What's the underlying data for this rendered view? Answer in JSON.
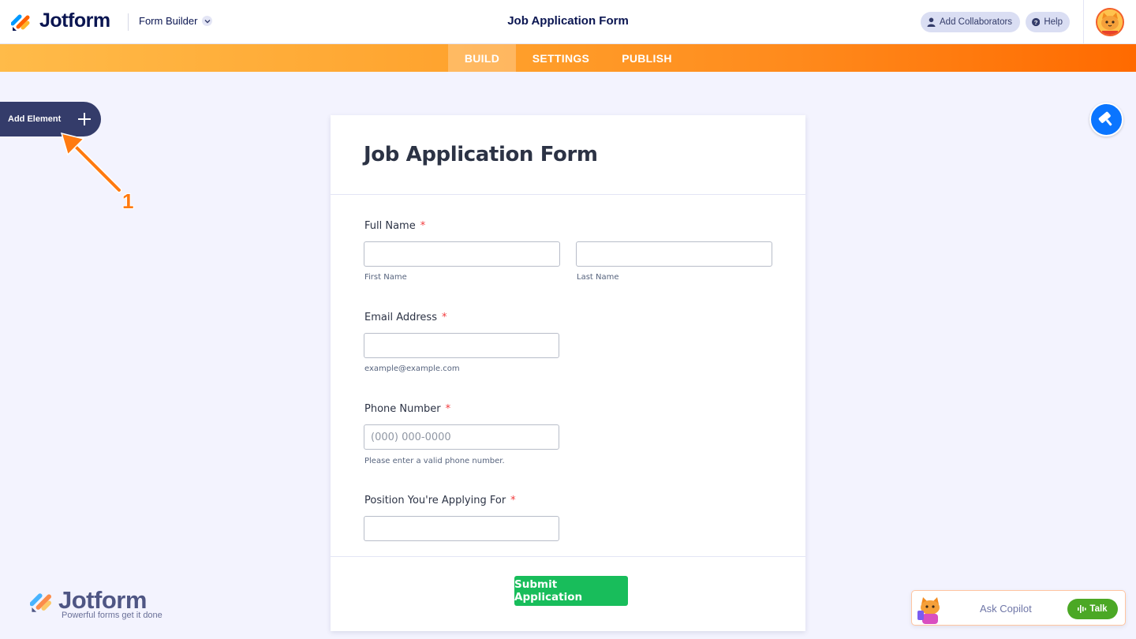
{
  "header": {
    "brand": "Jotform",
    "mode_label": "Form Builder",
    "title": "Job Application Form",
    "collaborators_label": "Add Collaborators",
    "help_label": "Help"
  },
  "nav": {
    "tabs": [
      {
        "label": "BUILD",
        "active": true
      },
      {
        "label": "SETTINGS",
        "active": false
      },
      {
        "label": "PUBLISH",
        "active": false
      }
    ]
  },
  "sidebar": {
    "add_element_label": "Add Element"
  },
  "annotation": {
    "number": "1"
  },
  "form": {
    "title": "Job Application Form",
    "fields": [
      {
        "label": "Full Name",
        "required": "*",
        "sublabels": [
          "First Name",
          "Last Name"
        ]
      },
      {
        "label": "Email Address",
        "required": "*",
        "sublabel": "example@example.com"
      },
      {
        "label": "Phone Number",
        "required": "*",
        "placeholder": "(000) 000-0000",
        "sublabel": "Please enter a valid phone number."
      },
      {
        "label": "Position You're Applying For",
        "required": "*"
      }
    ],
    "submit_label": "Submit Application"
  },
  "watermark": {
    "brand": "Jotform",
    "tagline": "Powerful forms get it done"
  },
  "copilot": {
    "placeholder": "Ask Copilot",
    "talk_label": "Talk"
  },
  "colors": {
    "accent_orange": "#ff6a00",
    "nav_gradient_start": "#ffbb49",
    "submit_green": "#18bd5b",
    "designer_blue": "#0a75ff",
    "dark_navy": "#0a1551",
    "talk_green": "#4ba825",
    "required_red": "#f23a3c"
  }
}
